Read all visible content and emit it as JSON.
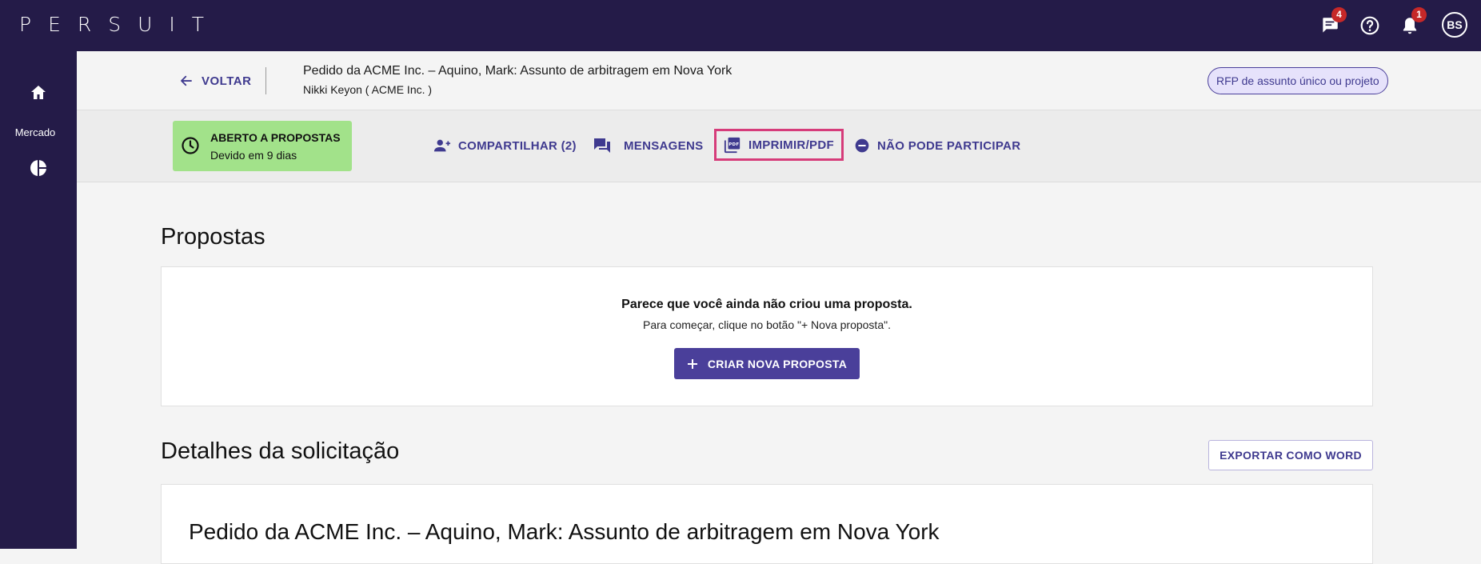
{
  "topbar": {
    "logo": "PERSUIT",
    "messages_badge": "4",
    "notifications_badge": "1",
    "avatar_initials": "BS"
  },
  "sidebar": {
    "market_label": "Mercado"
  },
  "header": {
    "back_label": "VOLTAR",
    "title": "Pedido da ACME Inc. – Aquino, Mark: Assunto de arbitragem em Nova York",
    "subtitle": "Nikki Keyon ( ACME Inc. )",
    "rfp_type": "RFP de assunto único ou projeto"
  },
  "status": {
    "label": "ABERTO A PROPOSTAS",
    "due": "Devido em 9 dias",
    "color": "#a2e28a"
  },
  "actions": {
    "share": "COMPARTILHAR (2)",
    "messages": "MENSAGENS",
    "print": "IMPRIMIR/PDF",
    "decline": "NÃO PODE PARTICIPAR"
  },
  "proposals": {
    "heading": "Propostas",
    "empty_title": "Parece que você ainda não criou uma proposta.",
    "empty_sub": "Para começar, clique no botão \"+ Nova proposta\".",
    "create_button": "CRIAR NOVA PROPOSTA"
  },
  "details": {
    "heading": "Detalhes da solicitação",
    "export_button": "EXPORTAR COMO WORD",
    "request_title": "Pedido da ACME Inc. – Aquino, Mark: Assunto de arbitragem em Nova York"
  },
  "colors": {
    "nav": "#241b48",
    "accent": "#3f3a8f",
    "highlight": "#d63c7a",
    "badge": "#c62828"
  }
}
